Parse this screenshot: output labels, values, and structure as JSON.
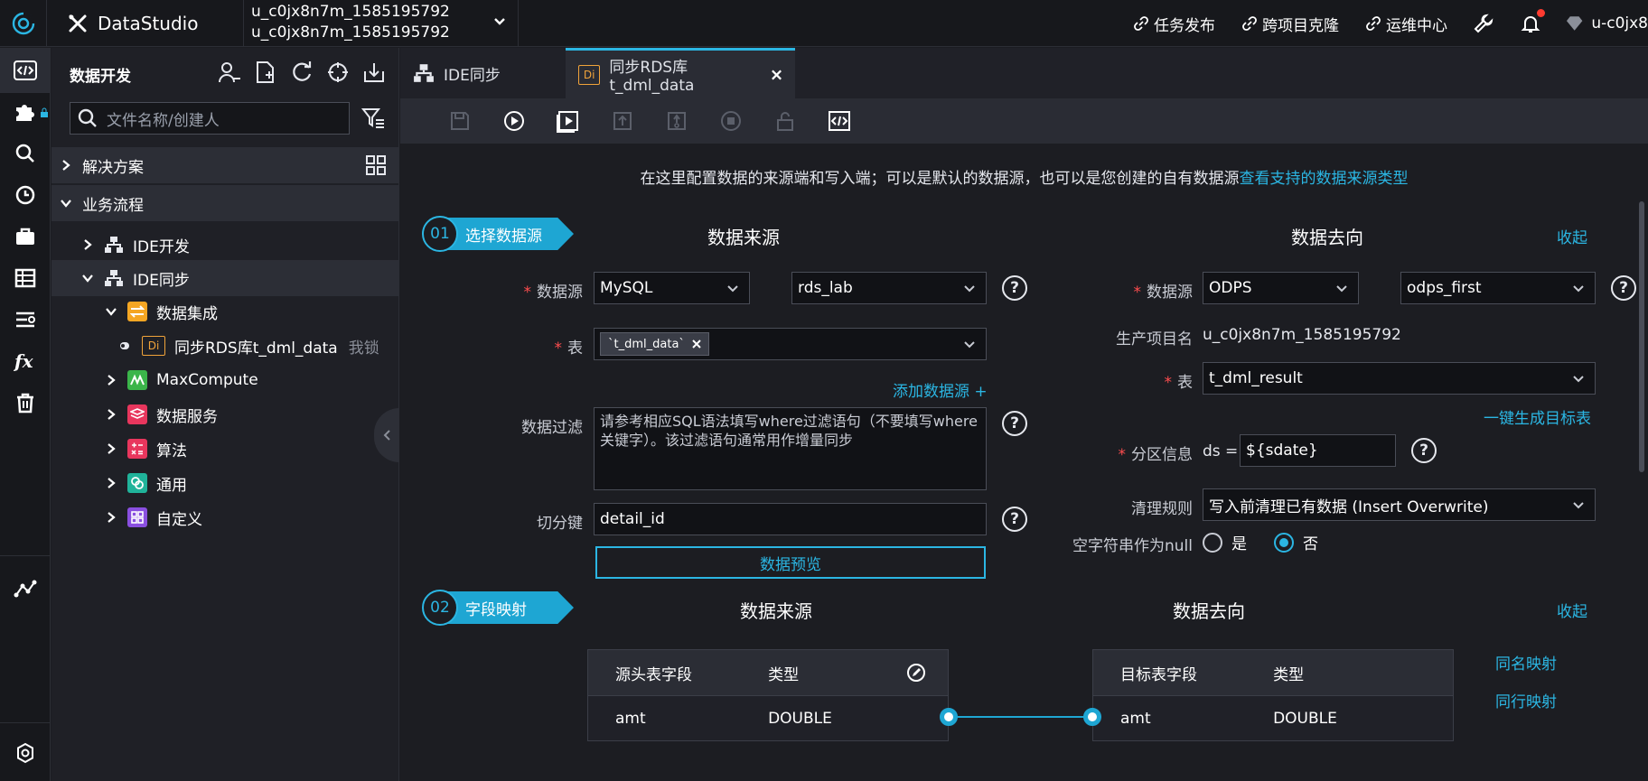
{
  "app": {
    "brand": "DataStudio"
  },
  "project": {
    "line1": "u_c0jx8n7m_1585195792",
    "line2": "u_c0jx8n7m_1585195792"
  },
  "topnav": {
    "publish": "任务发布",
    "clone": "跨项目克隆",
    "ops": "运维中心",
    "user": "u-c0jx8"
  },
  "sidebar": {
    "title": "数据开发",
    "search_placeholder": "文件名称/创建人",
    "sections": {
      "solutions": "解决方案",
      "workflows": "业务流程"
    },
    "tree": {
      "ide_dev": "IDE开发",
      "ide_sync": "IDE同步",
      "data_integration": "数据集成",
      "sync_node": "同步RDS库t_dml_data",
      "sync_node_badge": "Di",
      "lock_note": "我锁",
      "maxcompute": "MaxCompute",
      "data_service": "数据服务",
      "algorithm": "算法",
      "general": "通用",
      "custom": "自定义"
    }
  },
  "tabs": [
    {
      "label": "IDE同步"
    },
    {
      "label": "同步RDS库t_dml_data",
      "badge": "Di"
    }
  ],
  "config": {
    "info_text": "在这里配置数据的来源端和写入端；可以是默认的数据源，也可以是您创建的自有数据源",
    "info_link": "查看支持的数据来源类型",
    "step1": {
      "num": "01",
      "label": "选择数据源",
      "source_title": "数据来源",
      "target_title": "数据去向",
      "collapse": "收起"
    },
    "source": {
      "ds_label": "数据源",
      "ds_type": "MySQL",
      "ds_name": "rds_lab",
      "table_label": "表",
      "table_tag": "`t_dml_data`",
      "add_ds": "添加数据源 +",
      "filter_label": "数据过滤",
      "filter_placeholder": "请参考相应SQL语法填写where过滤语句（不要填写where关键字）。该过滤语句通常用作增量同步",
      "split_label": "切分键",
      "split_value": "detail_id",
      "preview": "数据预览"
    },
    "target": {
      "ds_label": "数据源",
      "ds_type": "ODPS",
      "ds_name": "odps_first",
      "project_label": "生产项目名",
      "project_value": "u_c0jx8n7m_1585195792",
      "table_label": "表",
      "table_value": "t_dml_result",
      "gen_table": "一键生成目标表",
      "partition_label": "分区信息",
      "partition_prefix": "ds =",
      "partition_value": "${sdate}",
      "clean_label": "清理规则",
      "clean_value": "写入前清理已有数据 (Insert Overwrite)",
      "null_label": "空字符串作为null",
      "yes": "是",
      "no": "否"
    },
    "step2": {
      "num": "02",
      "label": "字段映射",
      "source_title": "数据来源",
      "target_title": "数据去向",
      "collapse": "收起",
      "src_col_field": "源头表字段",
      "src_col_type": "类型",
      "tgt_col_field": "目标表字段",
      "tgt_col_type": "类型",
      "src_row": {
        "field": "amt",
        "type": "DOUBLE"
      },
      "tgt_row": {
        "field": "amt",
        "type": "DOUBLE"
      },
      "same_name": "同名映射",
      "same_row": "同行映射"
    }
  }
}
